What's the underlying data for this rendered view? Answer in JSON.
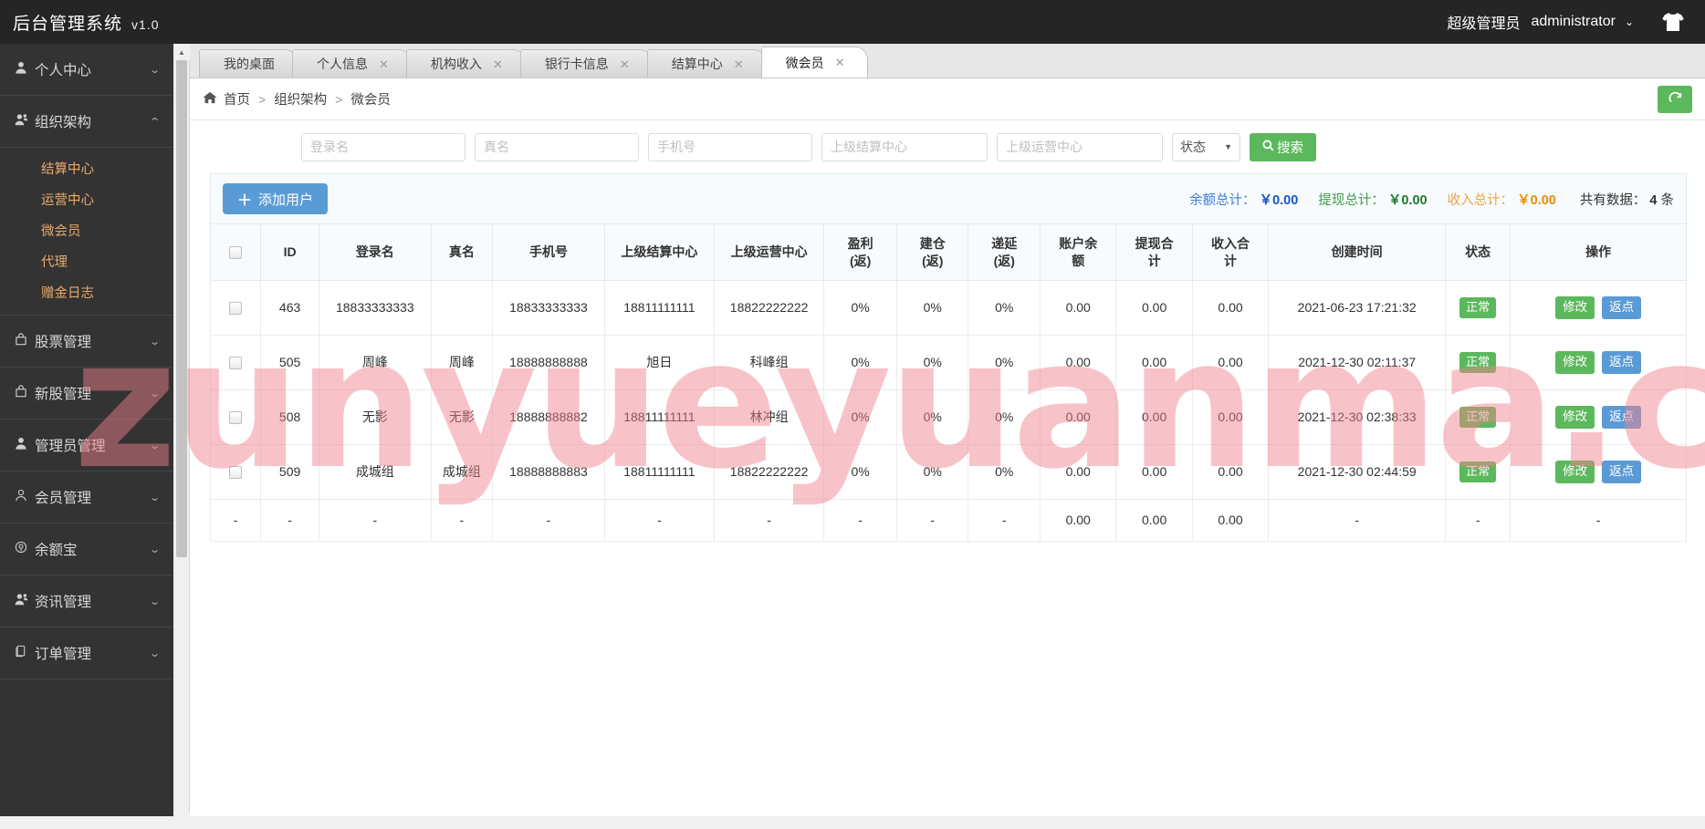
{
  "topbar": {
    "brand": "后台管理系统",
    "version": "v1.0",
    "role": "超级管理员",
    "username": "administrator",
    "caret": "⌄",
    "shirt_icon": "tshirt-icon"
  },
  "sidebar": {
    "items": [
      {
        "label": "个人中心",
        "icon": "user-icon",
        "arrow": "⌄",
        "expanded": false
      },
      {
        "label": "组织架构",
        "icon": "org-icon",
        "arrow": "⌃",
        "expanded": true
      },
      {
        "label": "股票管理",
        "icon": "bag-icon",
        "arrow": "⌄",
        "expanded": false
      },
      {
        "label": "新股管理",
        "icon": "bag-icon",
        "arrow": "⌄",
        "expanded": false
      },
      {
        "label": "管理员管理",
        "icon": "user-icon",
        "arrow": "⌄",
        "expanded": false
      },
      {
        "label": "会员管理",
        "icon": "user-outline-icon",
        "arrow": "⌄",
        "expanded": false
      },
      {
        "label": "余额宝",
        "icon": "coin-icon",
        "arrow": "⌄",
        "expanded": false
      },
      {
        "label": "资讯管理",
        "icon": "org-icon",
        "arrow": "⌄",
        "expanded": false
      },
      {
        "label": "订单管理",
        "icon": "doc-icon",
        "arrow": "⌄",
        "expanded": false
      }
    ],
    "submenu": [
      "结算中心",
      "运营中心",
      "微会员",
      "代理",
      "赠金日志"
    ]
  },
  "tabs": [
    {
      "label": "我的桌面",
      "closable": false,
      "active": false
    },
    {
      "label": "个人信息",
      "closable": true,
      "active": false
    },
    {
      "label": "机构收入",
      "closable": true,
      "active": false
    },
    {
      "label": "银行卡信息",
      "closable": true,
      "active": false
    },
    {
      "label": "结算中心",
      "closable": true,
      "active": false
    },
    {
      "label": "微会员",
      "closable": true,
      "active": true
    }
  ],
  "breadcrumb": {
    "home_icon": "home-icon",
    "items": [
      "首页",
      "组织架构",
      "微会员"
    ],
    "separator": ">",
    "refresh_icon": "refresh-icon"
  },
  "search": {
    "login_name_placeholder": "登录名",
    "real_name_placeholder": "真名",
    "phone_placeholder": "手机号",
    "parent_settle_placeholder": "上级结算中心",
    "parent_op_placeholder": "上级运营中心",
    "login_name_value": "",
    "real_name_value": "",
    "phone_value": "",
    "parent_settle_value": "",
    "parent_op_value": "",
    "status_label": "状态",
    "status_caret": "▼",
    "search_button": "搜索",
    "search_icon": "search-icon"
  },
  "toolbar": {
    "add_user_label": "添加用户",
    "plus_icon": "plus-icon",
    "balance_total_label": "余额总计：",
    "balance_total_value": "￥0.00",
    "withdraw_total_label": "提现总计：",
    "withdraw_total_value": "￥0.00",
    "income_total_label": "收入总计：",
    "income_total_value": "￥0.00",
    "count_prefix": "共有数据：",
    "count_value": "4",
    "count_suffix": "条"
  },
  "table": {
    "headers": [
      "",
      "ID",
      "登录名",
      "真名",
      "手机号",
      "上级结算中心",
      "上级运营中心",
      "盈利\n(返)",
      "建仓\n(返)",
      "递延\n(返)",
      "账户余\n额",
      "提现合\n计",
      "收入合\n计",
      "创建时间",
      "状态",
      "操作"
    ],
    "header_lines": [
      [
        "",
        ""
      ],
      [
        "ID",
        ""
      ],
      [
        "登录名",
        ""
      ],
      [
        "真名",
        ""
      ],
      [
        "手机号",
        ""
      ],
      [
        "上级结算中心",
        ""
      ],
      [
        "上级运营中心",
        ""
      ],
      [
        "盈利",
        "(返)"
      ],
      [
        "建仓",
        "(返)"
      ],
      [
        "递延",
        "(返)"
      ],
      [
        "账户余",
        "额"
      ],
      [
        "提现合",
        "计"
      ],
      [
        "收入合",
        "计"
      ],
      [
        "创建时间",
        ""
      ],
      [
        "状态",
        ""
      ],
      [
        "操作",
        ""
      ]
    ],
    "rows": [
      {
        "id": "463",
        "login": "18833333333",
        "realname": "",
        "phone": "18833333333",
        "parent_settle": "18811111111",
        "parent_op": "18822222222",
        "profit": "0%",
        "open": "0%",
        "defer": "0%",
        "balance": "0.00",
        "withdraw": "0.00",
        "income": "0.00",
        "created": "2021-06-23 17:21:32",
        "status": "正常",
        "edit": "修改",
        "rebate": "返点"
      },
      {
        "id": "505",
        "login": "周峰",
        "realname": "周峰",
        "phone": "18888888888",
        "parent_settle": "旭日",
        "parent_op": "科峰组",
        "profit": "0%",
        "open": "0%",
        "defer": "0%",
        "balance": "0.00",
        "withdraw": "0.00",
        "income": "0.00",
        "created": "2021-12-30 02:11:37",
        "status": "正常",
        "edit": "修改",
        "rebate": "返点"
      },
      {
        "id": "508",
        "login": "无影",
        "realname": "无影",
        "phone": "18888888882",
        "parent_settle": "18811111111",
        "parent_op": "林冲组",
        "profit": "0%",
        "open": "0%",
        "defer": "0%",
        "balance": "0.00",
        "withdraw": "0.00",
        "income": "0.00",
        "created": "2021-12-30 02:38:33",
        "status": "正常",
        "edit": "修改",
        "rebate": "返点"
      },
      {
        "id": "509",
        "login": "成城组",
        "realname": "成城组",
        "phone": "18888888883",
        "parent_settle": "18811111111",
        "parent_op": "18822222222",
        "profit": "0%",
        "open": "0%",
        "defer": "0%",
        "balance": "0.00",
        "withdraw": "0.00",
        "income": "0.00",
        "created": "2021-12-30 02:44:59",
        "status": "正常",
        "edit": "修改",
        "rebate": "返点"
      }
    ],
    "summary_row": {
      "id": "-",
      "login": "-",
      "realname": "-",
      "phone": "-",
      "parent_settle": "-",
      "parent_op": "-",
      "profit": "-",
      "open": "-",
      "defer": "-",
      "balance": "0.00",
      "withdraw": "0.00",
      "income": "0.00",
      "created": "-",
      "status": "-",
      "action": "-",
      "checkbox": "-"
    }
  },
  "watermark": {
    "text": "zunyueyuanma.com",
    "color": "#f0828c"
  },
  "colors": {
    "topbar_bg": "#252525",
    "sidebar_bg": "#333333",
    "submenu_text": "#e8a96b",
    "primary_blue": "#5b9bd5",
    "primary_green": "#5cb85c",
    "total_blue": "#1356c4",
    "total_green": "#1d7a2d",
    "total_orange": "#f08a00"
  }
}
